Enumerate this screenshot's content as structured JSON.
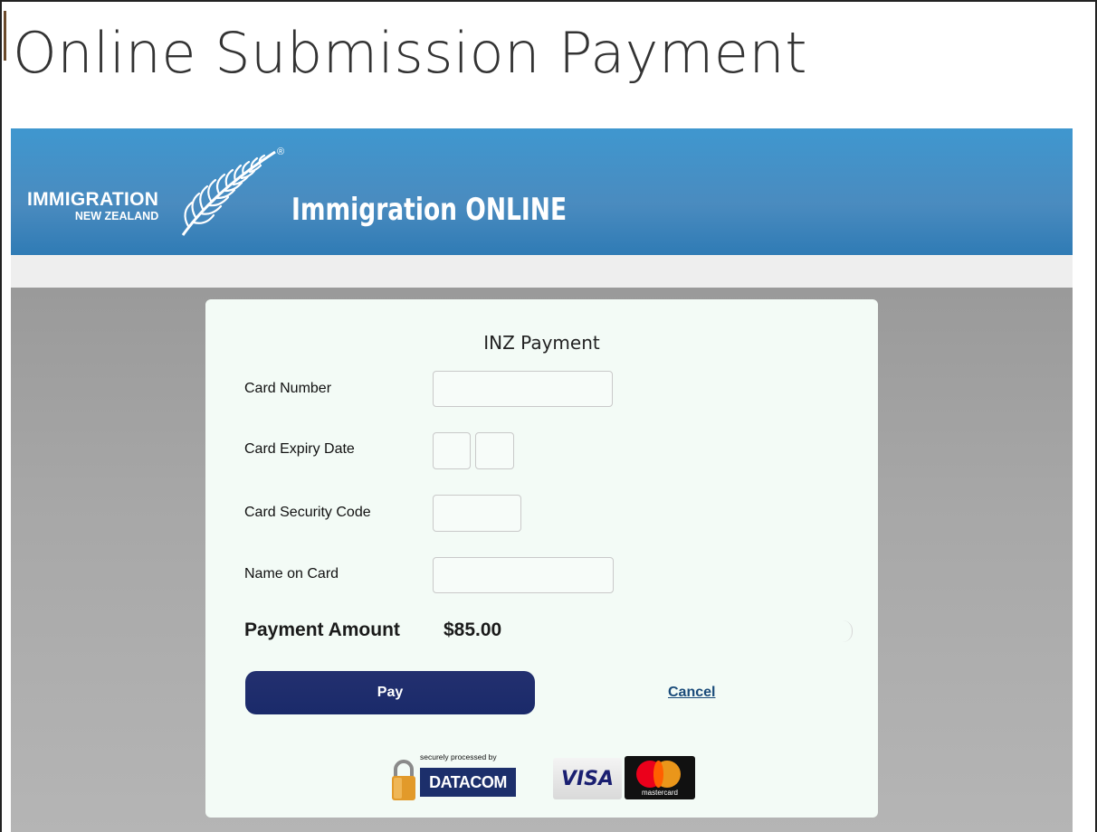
{
  "page": {
    "title": "Online Submission Payment"
  },
  "banner": {
    "logo_line1": "IMMIGRATION",
    "logo_line2": "NEW ZEALAND",
    "registered_mark": "®",
    "title": "Immigration ONLINE",
    "color": "#3f97cf"
  },
  "form": {
    "title": "INZ Payment",
    "card_number_label": "Card Number",
    "card_number_value": "",
    "expiry_label": "Card Expiry Date",
    "expiry_month_value": "",
    "expiry_year_value": "",
    "security_code_label": "Card Security Code",
    "security_code_value": "",
    "name_label": "Name on Card",
    "name_value": "",
    "amount_label": "Payment Amount",
    "amount_value": "$85.00",
    "pay_label": "Pay",
    "cancel_label": "Cancel",
    "pay_button_color": "#1a2a6a"
  },
  "footer": {
    "processed_by_text": "securely processed by",
    "datacom_label": "DATACOM",
    "visa_label": "VISA",
    "mastercard_label": "mastercard",
    "icons": [
      "padlock-icon",
      "datacom-logo",
      "visa-logo",
      "mastercard-logo"
    ]
  }
}
